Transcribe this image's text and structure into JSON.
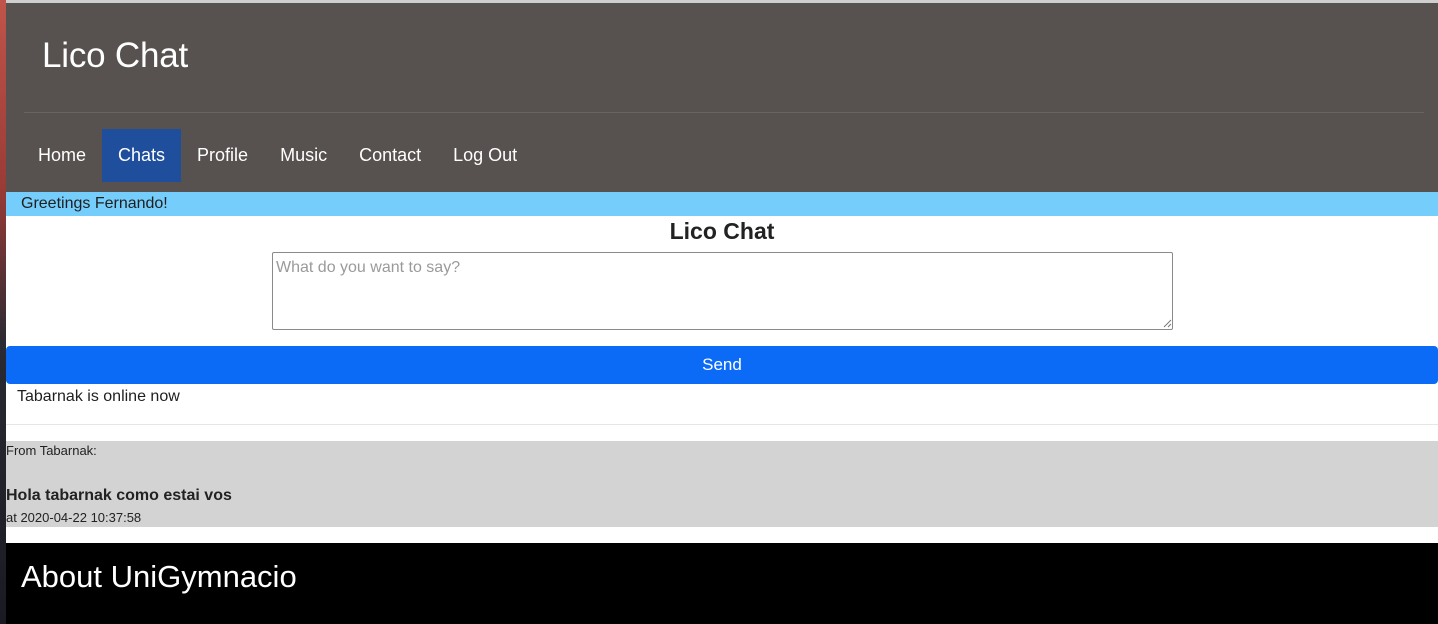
{
  "header": {
    "brand": "Lico Chat"
  },
  "nav": {
    "items": [
      {
        "label": "Home",
        "active": false
      },
      {
        "label": "Chats",
        "active": true
      },
      {
        "label": "Profile",
        "active": false
      },
      {
        "label": "Music",
        "active": false
      },
      {
        "label": "Contact",
        "active": false
      },
      {
        "label": "Log Out",
        "active": false
      }
    ]
  },
  "greeting": "Greetings Fernando!",
  "chat": {
    "title": "Lico Chat",
    "input_placeholder": "What do you want to say?",
    "input_value": "",
    "send_label": "Send",
    "online_status": "Tabarnak is online now"
  },
  "messages": [
    {
      "from": "From Tabarnak:",
      "text": "Hola tabarnak como estai vos",
      "time": "at 2020-04-22 10:37:58"
    }
  ],
  "footer": {
    "title": "About UniGymnacio"
  },
  "colors": {
    "header_bg": "#57524f",
    "nav_active": "#1f4e9c",
    "greeting_bg": "#74cdfb",
    "send_button": "#0b6bf7",
    "message_bg": "#d3d3d3",
    "footer_bg": "#000000"
  }
}
